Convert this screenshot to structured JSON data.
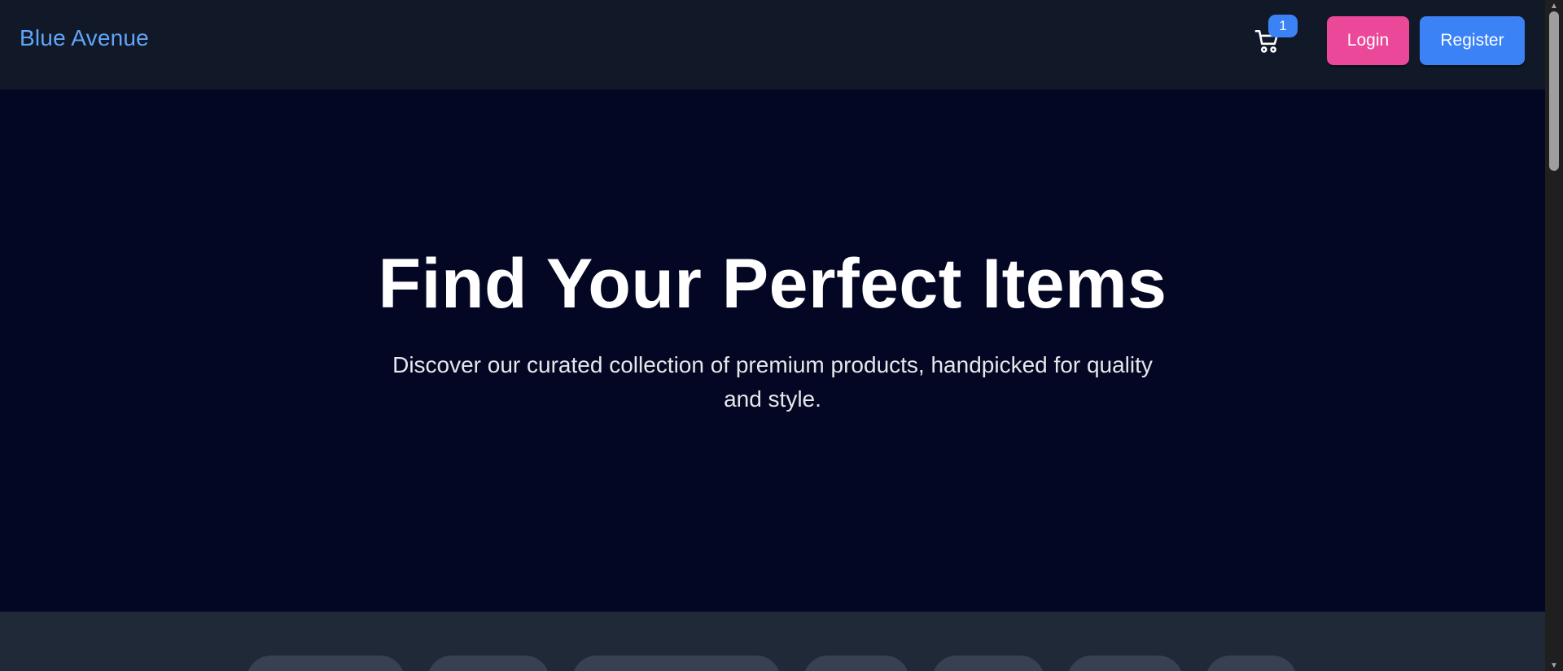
{
  "header": {
    "brand": "Blue Avenue",
    "cart_count": "1",
    "login_label": "Login",
    "register_label": "Register"
  },
  "hero": {
    "title": "Find Your Perfect Items",
    "subtitle": "Discover our curated collection of premium products, handpicked for quality and style."
  },
  "filters": {
    "pills": [
      "",
      "",
      "",
      "",
      "",
      "",
      ""
    ]
  },
  "colors": {
    "brand": "#60a5fa",
    "login": "#ec4899",
    "register": "#3b82f6",
    "hero_bg": "#030723",
    "navbar_bg": "#111827"
  },
  "icons": {
    "cart": "shopping-cart-icon",
    "scroll_up": "chevron-up-icon",
    "scroll_down": "chevron-down-icon"
  }
}
